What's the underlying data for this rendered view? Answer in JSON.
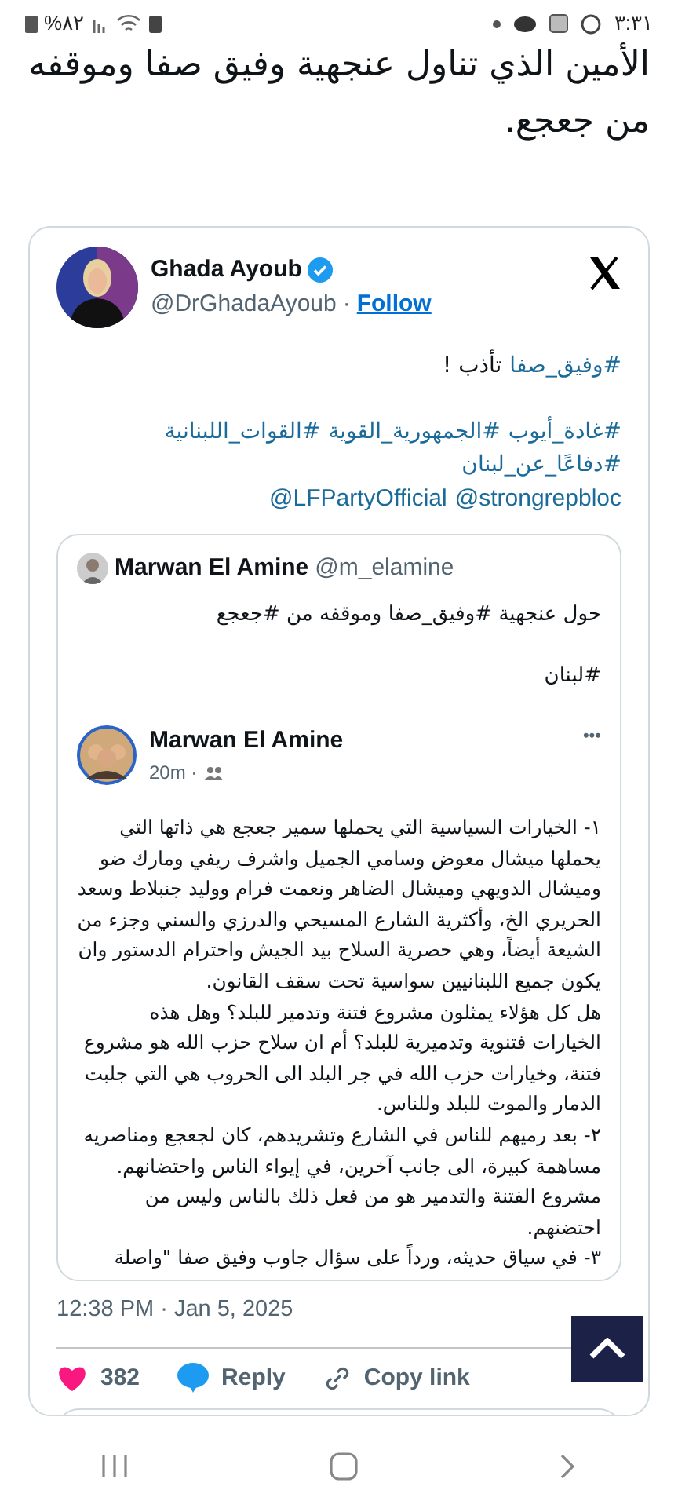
{
  "status_bar": {
    "time": "٣:٣١",
    "battery": "%٨٢"
  },
  "headline": "الأمين الذي تناول عنجهية وفيق صفا وموقفه من جعجع.",
  "tweet": {
    "author": {
      "name": "Ghada Ayoub",
      "verified": true,
      "handle": "@DrGhadaAyoub",
      "separator": "·",
      "follow": "Follow"
    },
    "lines": [
      [
        {
          "kind": "hashtag",
          "text": "#وفيق_صفا"
        },
        {
          "kind": "plain",
          "text": "تأذب !"
        }
      ],
      [
        {
          "kind": "hashtag",
          "text": "#غادة_أيوب"
        },
        {
          "kind": "hashtag",
          "text": "#الجمهورية_القوية"
        },
        {
          "kind": "hashtag",
          "text": "#القوات_اللبنانية"
        }
      ],
      [
        {
          "kind": "hashtag",
          "text": "#دفاعًا_عن_لبنان"
        }
      ],
      [
        {
          "kind": "mention",
          "text": "@strongrepbloc"
        },
        {
          "kind": "mention",
          "text": "@LFPartyOfficial"
        }
      ]
    ],
    "quote": {
      "author": "Marwan El Amine",
      "handle": "@m_elamine",
      "text": "حول عنجهية #وفيق_صفا وموقفه من #جعجع",
      "tag": "#لبنان",
      "post": {
        "author": "Marwan El Amine",
        "time": "20m ·",
        "more": "•••",
        "paragraphs": [
          "١- الخيارات السياسية التي يحملها سمير جعجع هي ذاتها التي يحملها ميشال معوض وسامي الجميل واشرف ريفي ومارك ضو وميشال الدويهي وميشال الضاهر ونعمت فرام ووليد جنبلاط وسعد الحريري الخ، وأكثرية الشارع المسيحي والدرزي والسني وجزء من الشيعة أيضاً، وهي حصرية السلاح بيد الجيش واحترام الدستور وان يكون جميع اللبنانيين سواسية تحت سقف القانون.",
          "هل كل هؤلاء يمثلون مشروع فتنة وتدمير للبلد؟ وهل هذه الخيارات فتنوية وتدميرية للبلد؟ أم ان سلاح حزب الله هو مشروع فتنة، وخيارات حزب الله في جر البلد الى الحروب هي التي جلبت الدمار والموت للبلد وللناس.",
          "٢- بعد رميهم للناس في الشارع وتشريدهم، كان لجعجع ومناصريه مساهمة كبيرة، الى جانب آخرين، في إيواء الناس واحتضانهم. مشروع الفتنة والتدمير هو من فعل ذلك بالناس وليس من احتضنهم.",
          "٣- في سياق حديثه، ورداً على سؤال جاوب وفيق صفا \"واصلة"
        ]
      }
    },
    "timestamp": "12:38 PM · Jan 5, 2025",
    "like_count": "382",
    "reply_label": "Reply",
    "copy_link_label": "Copy link"
  }
}
